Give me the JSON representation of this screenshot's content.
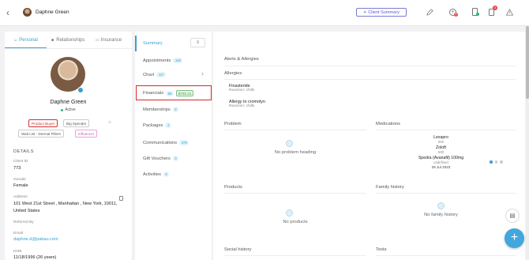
{
  "header": {
    "client_name": "Daphne Green",
    "client_summary_label": "Client Summary",
    "notify_count": "3",
    "dot_badge": "8"
  },
  "profile_tabs": [
    {
      "label": "Personal",
      "active": true
    },
    {
      "label": "Relationships",
      "active": false
    },
    {
      "label": "Insurance",
      "active": false
    }
  ],
  "profile": {
    "name": "Daphne Green",
    "status": "Active",
    "tags": [
      "Product Buyer",
      "Big Spender",
      "Wait List - Dermal Fillers",
      "Influencer"
    ]
  },
  "details": {
    "heading": "DETAILS",
    "client_id_label": "Client ID",
    "client_id": "773",
    "gender_label": "Gender",
    "gender": "Female",
    "address_label": "Address",
    "address": "101 West 21st Street , Manhattan , New York, 10011, United States",
    "referred_label": "Referred By",
    "email_label": "Email",
    "email": "daphne.d@pabau.com",
    "dob_label": "DOB",
    "dob": "11/18/1996 (26 years)"
  },
  "nav": {
    "items": [
      {
        "label": "Summary",
        "badge": ""
      },
      {
        "label": "Appointments",
        "badge": "140"
      },
      {
        "label": "Chart",
        "badge": "117"
      },
      {
        "label": "Financials",
        "badge": "86",
        "amount": "$730.31"
      },
      {
        "label": "Memberships",
        "badge": "0"
      },
      {
        "label": "Packages",
        "badge": "4"
      },
      {
        "label": "Communications",
        "badge": "379"
      },
      {
        "label": "Gift Vouchers",
        "badge": "0"
      },
      {
        "label": "Activities",
        "badge": "0"
      }
    ]
  },
  "sections": {
    "alerts": "Alerts & Allergies",
    "allergies": "Allergies",
    "allergy_items": [
      {
        "name": "Finasteride",
        "reaction": "Reaction: chills"
      },
      {
        "name": "Allergy to cromolyn",
        "reaction": "Reaction: chills"
      }
    ],
    "problem": "Problem",
    "problem_empty": "No problem heading",
    "medications": "Medications",
    "med_items": [
      {
        "name": "Lexapro",
        "sub": "500"
      },
      {
        "name": "Zoloft",
        "sub": "500"
      },
      {
        "name": "Spedra (Avanafil) 100mg",
        "sub": "undefined"
      }
    ],
    "med_date": "29 Jul 2023",
    "products": "Products",
    "products_empty": "No products",
    "family": "Family history",
    "family_empty": "No family history",
    "social": "Social history",
    "tests": "Tests"
  },
  "colors": {
    "accent": "#3a9fd0",
    "highlight_box": "#d9262a",
    "amount_green": "#3c9c3f",
    "fab": "#41a7dd"
  }
}
